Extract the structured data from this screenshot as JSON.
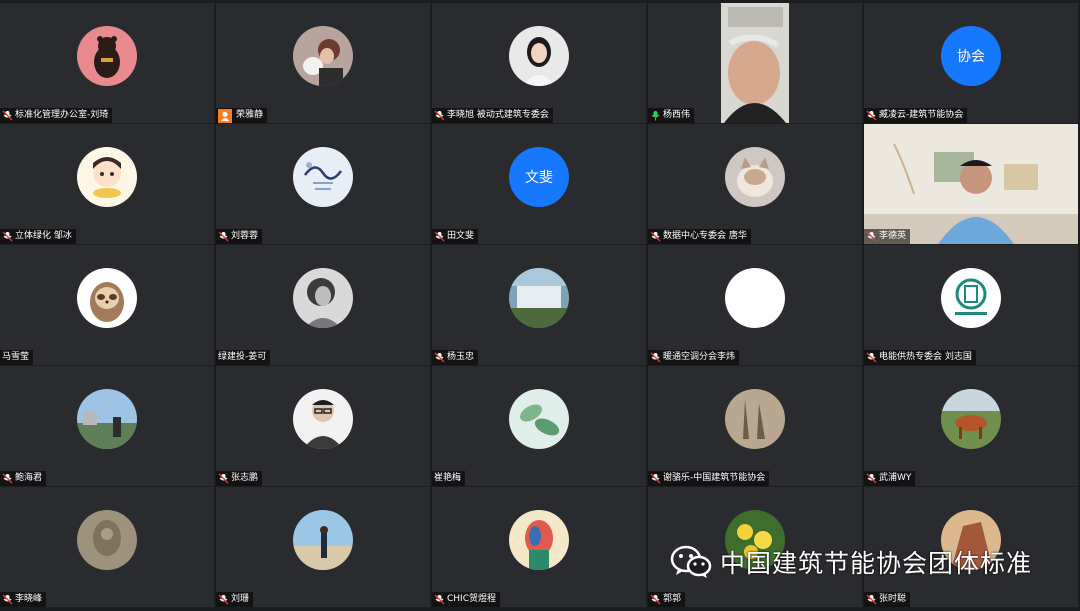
{
  "participants": [
    {
      "name": "标准化管理办公室-刘琦",
      "avatar": "bear-icon",
      "mic": "muted"
    },
    {
      "name": "荣雅静",
      "avatar": "photo-woman-cat-icon",
      "mic": "host"
    },
    {
      "name": "李晓旭 被动式建筑专委会",
      "avatar": "photo-woman-portrait-icon",
      "mic": "muted"
    },
    {
      "name": "杨西伟",
      "avatar": "video-feed",
      "mic": "active"
    },
    {
      "name": "臧凌云-建筑节能协会",
      "avatar_text": "协会",
      "mic": "muted"
    },
    {
      "name": "立体绿化 邹冰",
      "avatar": "cartoon-child-icon",
      "mic": "muted"
    },
    {
      "name": "刘蓉蓉",
      "avatar": "calligraphy-icon",
      "mic": "muted"
    },
    {
      "name": "田文斐",
      "avatar_text": "文斐",
      "mic": "muted"
    },
    {
      "name": "数据中心专委会 唐华",
      "avatar": "photo-cat-icon",
      "mic": "muted"
    },
    {
      "name": "李德英",
      "avatar": "video-feed",
      "mic": "muted"
    },
    {
      "name": "马雪莹",
      "avatar": "sloth-icon",
      "mic": "none"
    },
    {
      "name": "绿建投-姜可",
      "avatar": "photo-woman-bw-icon",
      "mic": "none"
    },
    {
      "name": "杨玉忠",
      "avatar": "photo-waterfall-icon",
      "mic": "muted"
    },
    {
      "name": "暖通空调分会李炜",
      "avatar": "blank-white-icon",
      "mic": "muted"
    },
    {
      "name": "电能供热专委会  刘志国",
      "avatar": "logo-badge-icon",
      "mic": "muted"
    },
    {
      "name": "鲍海君",
      "avatar": "photo-landscape-person-icon",
      "mic": "muted"
    },
    {
      "name": "张志鹏",
      "avatar": "photo-man-glasses-icon",
      "mic": "muted"
    },
    {
      "name": "崔艳梅",
      "avatar": "photo-leaves-icon",
      "mic": "none"
    },
    {
      "name": "谢骆乐-中国建筑节能协会",
      "avatar": "photo-shadows-icon",
      "mic": "muted"
    },
    {
      "name": "武浦WY",
      "avatar": "photo-horse-icon",
      "mic": "muted"
    },
    {
      "name": "李晓峰",
      "avatar": "photo-statue-icon",
      "mic": "muted"
    },
    {
      "name": "刘珊",
      "avatar": "photo-beach-person-icon",
      "mic": "muted"
    },
    {
      "name": "CHIC贺煜程",
      "avatar": "art-face-icon",
      "mic": "muted"
    },
    {
      "name": "郭郭",
      "avatar": "photo-flowers-icon",
      "mic": "muted"
    },
    {
      "name": "张时聪",
      "avatar": "photo-rock-icon",
      "mic": "muted"
    }
  ],
  "watermark": {
    "text": "中国建筑节能协会团体标准",
    "icon": "wechat-icon"
  },
  "colors": {
    "tile_bg": "#2a2b2e",
    "active_border": "#2fae5e",
    "text_avatar_bg": "#1677ff",
    "host_badge": "#ff7a1a"
  }
}
